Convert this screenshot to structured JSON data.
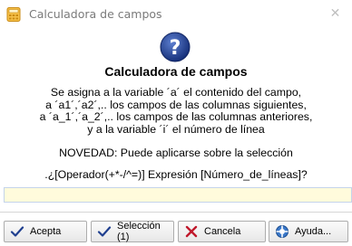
{
  "window": {
    "title": "Calculadora de campos",
    "close_glyph": "✕",
    "icons": {
      "app": "calculator-icon",
      "close": "close-icon"
    }
  },
  "dialog": {
    "icon": "question-icon",
    "heading": "Calculadora de campos",
    "lines": [
      "Se asigna a la variable ´a´ el contenido del campo,",
      "a ´a1´,´a2´,.. los campos de las columnas siguientes,",
      "a ´a_1´,´a_2´,.. los campos de las columnas anteriores,",
      "y a la variable ´i´ el número de línea"
    ],
    "novedad": "NOVEDAD: Puede aplicarse sobre la selección",
    "prompt": ".¿[Operador(+*-/^=)]  Expresión  [Número_de_líneas]?",
    "input": {
      "value": "",
      "placeholder": ""
    }
  },
  "buttons": [
    {
      "label": "Acepta",
      "icon": "checkmark-icon"
    },
    {
      "label": "Selección (1)",
      "icon": "checkmark-icon"
    },
    {
      "label": "Cancela",
      "icon": "cross-icon"
    },
    {
      "label": "Ayuda...",
      "icon": "help-icon"
    }
  ],
  "colors": {
    "question_icon": "#1f3a8c",
    "input_bg": "#fffbdc",
    "checkmark": "#1f3f8f",
    "cross": "#c0182b",
    "title_text": "#7a7a7a"
  }
}
